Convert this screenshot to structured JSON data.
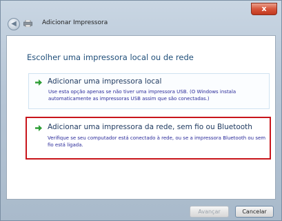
{
  "window": {
    "title": "Adicionar Impressora",
    "close_label": "x"
  },
  "icons": {
    "back": "back-arrow-icon",
    "printer": "printer-icon",
    "option_arrow": "green-arrow-icon"
  },
  "main": {
    "heading": "Escolher uma impressora local ou de rede",
    "options": [
      {
        "title": "Adicionar uma impressora local",
        "description": "Use esta opção apenas se não tiver uma impressora USB. (O Windows instala automaticamente as impressoras USB assim que são conectadas.)"
      },
      {
        "title": "Adicionar uma impressora da rede, sem fio ou Bluetooth",
        "description": "Verifique se seu computador está conectado à rede, ou se a impressora Bluetooth ou sem fio está ligada."
      }
    ]
  },
  "footer": {
    "next_label": "Avançar",
    "cancel_label": "Cancelar"
  },
  "colors": {
    "highlight_border": "#c8141a",
    "arrow_green": "#2e9e36",
    "heading": "#1f4e79"
  }
}
